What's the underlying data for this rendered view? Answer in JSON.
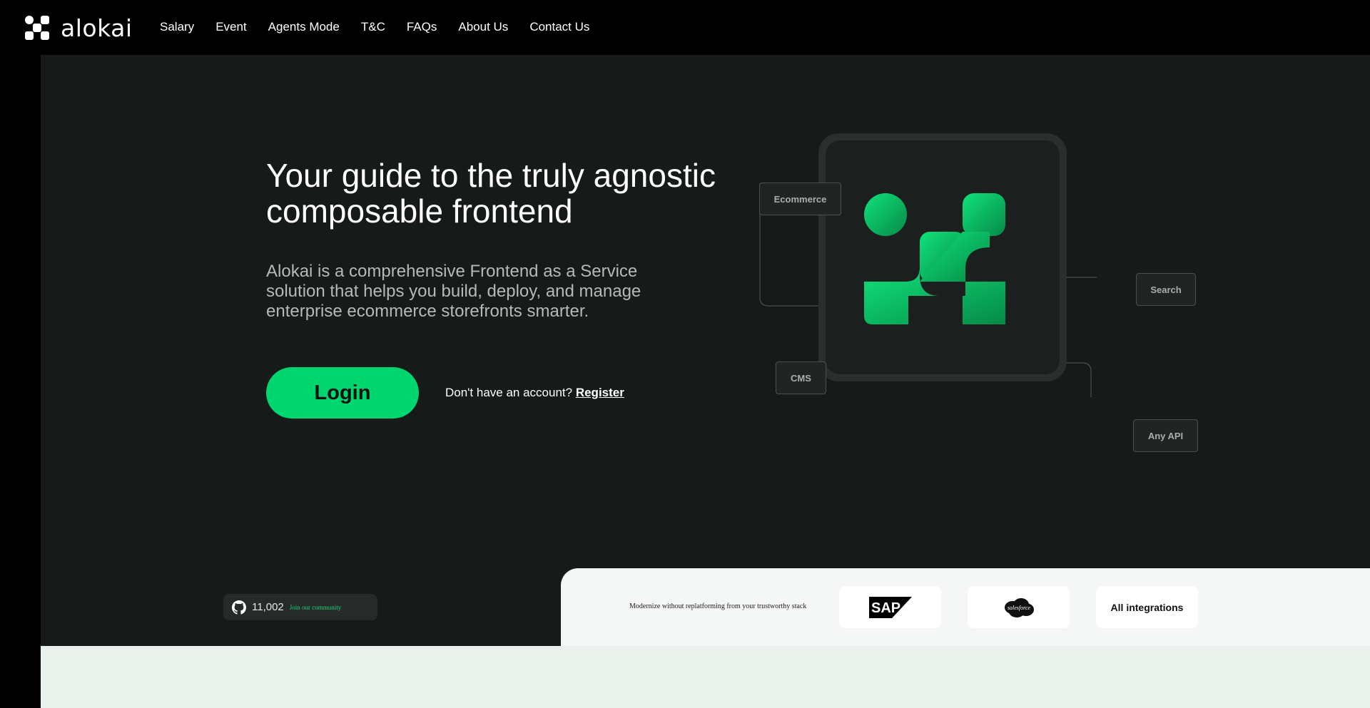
{
  "brand": {
    "name": "alokai"
  },
  "nav": [
    {
      "label": "Salary"
    },
    {
      "label": "Event"
    },
    {
      "label": "Agents Mode"
    },
    {
      "label": "T&C"
    },
    {
      "label": "FAQs"
    },
    {
      "label": "About Us"
    },
    {
      "label": "Contact Us"
    }
  ],
  "hero": {
    "headline": "Your guide to the truly agnostic composable frontend",
    "subcopy": "Alokai is a comprehensive Frontend as a Service solution that helps you build, deploy, and manage enterprise ecommerce storefronts smarter.",
    "login_label": "Login",
    "no_account_text": "Don't have an account?",
    "register_label": "Register"
  },
  "diagram": {
    "tags": {
      "ecommerce": "Ecommerce",
      "search": "Search",
      "cms": "CMS",
      "any_api": "Any API"
    }
  },
  "community": {
    "count": "11,002",
    "join_label": "Join our community"
  },
  "partners": {
    "message": "Modernize without replatforming from your trustworthy stack",
    "sap_label": "SAP",
    "salesforce_label": "salesforce",
    "all_label": "All integrations"
  },
  "colors": {
    "accent": "#00d66f",
    "panel": "#161a18",
    "header": "#000000"
  }
}
